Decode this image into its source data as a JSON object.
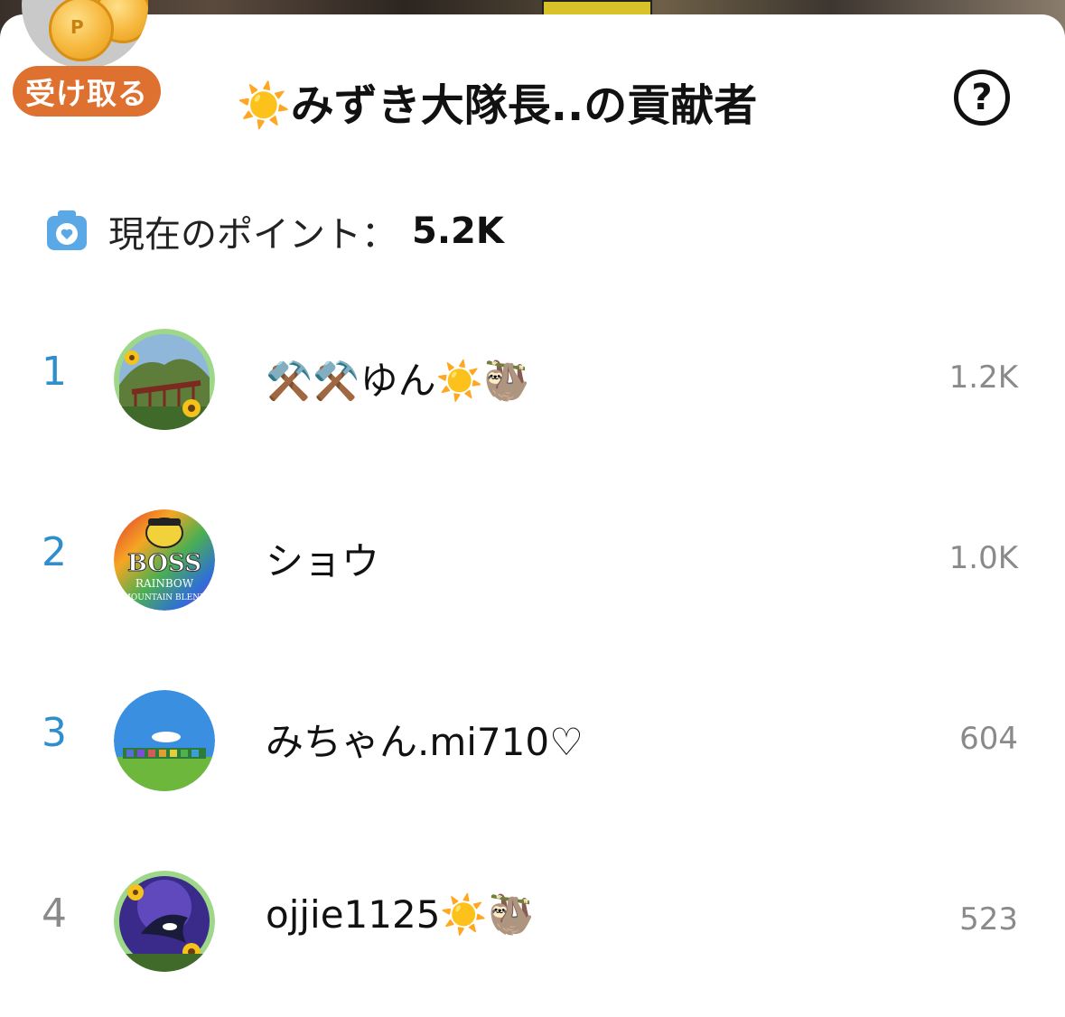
{
  "reward": {
    "label": "受け取る"
  },
  "header": {
    "title": "☀️みずき大隊長..の貢献者"
  },
  "points": {
    "label": "現在のポイント：",
    "value": "5.2K"
  },
  "contributors": [
    {
      "rank": "1",
      "name": "⚒️⚒️ゆん☀️🦥",
      "score": "1.2K",
      "avatar": "sunflower-bridge-avatar"
    },
    {
      "rank": "2",
      "name": "ショウ",
      "score": "1.0K",
      "avatar": "boss-rainbow-avatar"
    },
    {
      "rank": "3",
      "name": "みちゃん.mi710♡",
      "score": "604",
      "avatar": "meadow-sky-avatar"
    },
    {
      "rank": "4",
      "name": "ojjie1125☀️🦥",
      "score": "523",
      "avatar": "orca-sunflower-avatar"
    }
  ],
  "colors": {
    "accent_blue": "#2f8ecb",
    "reward_orange": "#df7130",
    "muted_gray": "#8a8a8a"
  }
}
